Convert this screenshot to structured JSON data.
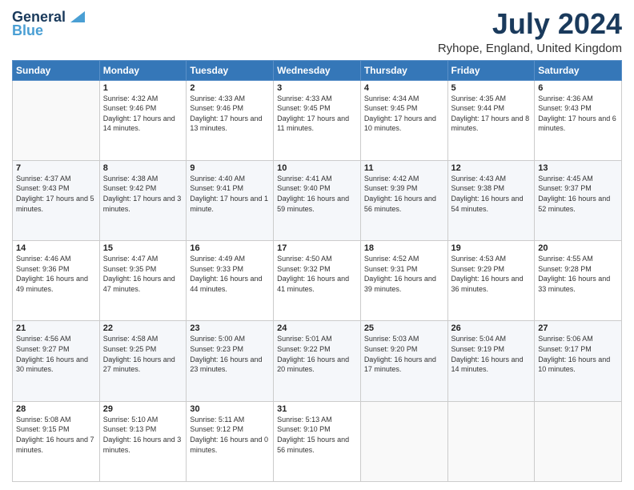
{
  "header": {
    "logo_line1": "General",
    "logo_line2": "Blue",
    "month_year": "July 2024",
    "location": "Ryhope, England, United Kingdom"
  },
  "days_of_week": [
    "Sunday",
    "Monday",
    "Tuesday",
    "Wednesday",
    "Thursday",
    "Friday",
    "Saturday"
  ],
  "weeks": [
    [
      {
        "day": "",
        "sunrise": "",
        "sunset": "",
        "daylight": ""
      },
      {
        "day": "1",
        "sunrise": "Sunrise: 4:32 AM",
        "sunset": "Sunset: 9:46 PM",
        "daylight": "Daylight: 17 hours and 14 minutes."
      },
      {
        "day": "2",
        "sunrise": "Sunrise: 4:33 AM",
        "sunset": "Sunset: 9:46 PM",
        "daylight": "Daylight: 17 hours and 13 minutes."
      },
      {
        "day": "3",
        "sunrise": "Sunrise: 4:33 AM",
        "sunset": "Sunset: 9:45 PM",
        "daylight": "Daylight: 17 hours and 11 minutes."
      },
      {
        "day": "4",
        "sunrise": "Sunrise: 4:34 AM",
        "sunset": "Sunset: 9:45 PM",
        "daylight": "Daylight: 17 hours and 10 minutes."
      },
      {
        "day": "5",
        "sunrise": "Sunrise: 4:35 AM",
        "sunset": "Sunset: 9:44 PM",
        "daylight": "Daylight: 17 hours and 8 minutes."
      },
      {
        "day": "6",
        "sunrise": "Sunrise: 4:36 AM",
        "sunset": "Sunset: 9:43 PM",
        "daylight": "Daylight: 17 hours and 6 minutes."
      }
    ],
    [
      {
        "day": "7",
        "sunrise": "Sunrise: 4:37 AM",
        "sunset": "Sunset: 9:43 PM",
        "daylight": "Daylight: 17 hours and 5 minutes."
      },
      {
        "day": "8",
        "sunrise": "Sunrise: 4:38 AM",
        "sunset": "Sunset: 9:42 PM",
        "daylight": "Daylight: 17 hours and 3 minutes."
      },
      {
        "day": "9",
        "sunrise": "Sunrise: 4:40 AM",
        "sunset": "Sunset: 9:41 PM",
        "daylight": "Daylight: 17 hours and 1 minute."
      },
      {
        "day": "10",
        "sunrise": "Sunrise: 4:41 AM",
        "sunset": "Sunset: 9:40 PM",
        "daylight": "Daylight: 16 hours and 59 minutes."
      },
      {
        "day": "11",
        "sunrise": "Sunrise: 4:42 AM",
        "sunset": "Sunset: 9:39 PM",
        "daylight": "Daylight: 16 hours and 56 minutes."
      },
      {
        "day": "12",
        "sunrise": "Sunrise: 4:43 AM",
        "sunset": "Sunset: 9:38 PM",
        "daylight": "Daylight: 16 hours and 54 minutes."
      },
      {
        "day": "13",
        "sunrise": "Sunrise: 4:45 AM",
        "sunset": "Sunset: 9:37 PM",
        "daylight": "Daylight: 16 hours and 52 minutes."
      }
    ],
    [
      {
        "day": "14",
        "sunrise": "Sunrise: 4:46 AM",
        "sunset": "Sunset: 9:36 PM",
        "daylight": "Daylight: 16 hours and 49 minutes."
      },
      {
        "day": "15",
        "sunrise": "Sunrise: 4:47 AM",
        "sunset": "Sunset: 9:35 PM",
        "daylight": "Daylight: 16 hours and 47 minutes."
      },
      {
        "day": "16",
        "sunrise": "Sunrise: 4:49 AM",
        "sunset": "Sunset: 9:33 PM",
        "daylight": "Daylight: 16 hours and 44 minutes."
      },
      {
        "day": "17",
        "sunrise": "Sunrise: 4:50 AM",
        "sunset": "Sunset: 9:32 PM",
        "daylight": "Daylight: 16 hours and 41 minutes."
      },
      {
        "day": "18",
        "sunrise": "Sunrise: 4:52 AM",
        "sunset": "Sunset: 9:31 PM",
        "daylight": "Daylight: 16 hours and 39 minutes."
      },
      {
        "day": "19",
        "sunrise": "Sunrise: 4:53 AM",
        "sunset": "Sunset: 9:29 PM",
        "daylight": "Daylight: 16 hours and 36 minutes."
      },
      {
        "day": "20",
        "sunrise": "Sunrise: 4:55 AM",
        "sunset": "Sunset: 9:28 PM",
        "daylight": "Daylight: 16 hours and 33 minutes."
      }
    ],
    [
      {
        "day": "21",
        "sunrise": "Sunrise: 4:56 AM",
        "sunset": "Sunset: 9:27 PM",
        "daylight": "Daylight: 16 hours and 30 minutes."
      },
      {
        "day": "22",
        "sunrise": "Sunrise: 4:58 AM",
        "sunset": "Sunset: 9:25 PM",
        "daylight": "Daylight: 16 hours and 27 minutes."
      },
      {
        "day": "23",
        "sunrise": "Sunrise: 5:00 AM",
        "sunset": "Sunset: 9:23 PM",
        "daylight": "Daylight: 16 hours and 23 minutes."
      },
      {
        "day": "24",
        "sunrise": "Sunrise: 5:01 AM",
        "sunset": "Sunset: 9:22 PM",
        "daylight": "Daylight: 16 hours and 20 minutes."
      },
      {
        "day": "25",
        "sunrise": "Sunrise: 5:03 AM",
        "sunset": "Sunset: 9:20 PM",
        "daylight": "Daylight: 16 hours and 17 minutes."
      },
      {
        "day": "26",
        "sunrise": "Sunrise: 5:04 AM",
        "sunset": "Sunset: 9:19 PM",
        "daylight": "Daylight: 16 hours and 14 minutes."
      },
      {
        "day": "27",
        "sunrise": "Sunrise: 5:06 AM",
        "sunset": "Sunset: 9:17 PM",
        "daylight": "Daylight: 16 hours and 10 minutes."
      }
    ],
    [
      {
        "day": "28",
        "sunrise": "Sunrise: 5:08 AM",
        "sunset": "Sunset: 9:15 PM",
        "daylight": "Daylight: 16 hours and 7 minutes."
      },
      {
        "day": "29",
        "sunrise": "Sunrise: 5:10 AM",
        "sunset": "Sunset: 9:13 PM",
        "daylight": "Daylight: 16 hours and 3 minutes."
      },
      {
        "day": "30",
        "sunrise": "Sunrise: 5:11 AM",
        "sunset": "Sunset: 9:12 PM",
        "daylight": "Daylight: 16 hours and 0 minutes."
      },
      {
        "day": "31",
        "sunrise": "Sunrise: 5:13 AM",
        "sunset": "Sunset: 9:10 PM",
        "daylight": "Daylight: 15 hours and 56 minutes."
      },
      {
        "day": "",
        "sunrise": "",
        "sunset": "",
        "daylight": ""
      },
      {
        "day": "",
        "sunrise": "",
        "sunset": "",
        "daylight": ""
      },
      {
        "day": "",
        "sunrise": "",
        "sunset": "",
        "daylight": ""
      }
    ]
  ]
}
